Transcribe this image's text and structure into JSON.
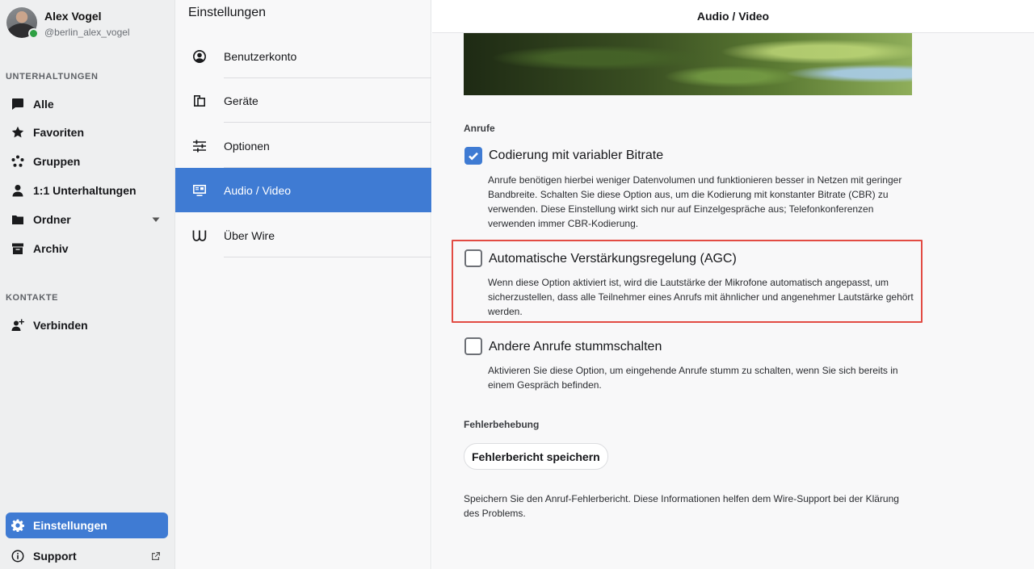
{
  "user": {
    "name": "Alex Vogel",
    "handle": "@berlin_alex_vogel"
  },
  "sidebar": {
    "conversations_title": "UNTERHALTUNGEN",
    "items": [
      {
        "label": "Alle",
        "icon": "chat-bubble-icon"
      },
      {
        "label": "Favoriten",
        "icon": "star-icon"
      },
      {
        "label": "Gruppen",
        "icon": "group-icon"
      },
      {
        "label": "1:1 Unterhaltungen",
        "icon": "person-icon"
      },
      {
        "label": "Ordner",
        "icon": "folder-icon"
      },
      {
        "label": "Archiv",
        "icon": "archive-icon"
      }
    ],
    "contacts_title": "KONTAKTE",
    "connect_label": "Verbinden",
    "settings_label": "Einstellungen",
    "support_label": "Support"
  },
  "settings_menu": {
    "title": "Einstellungen",
    "items": [
      {
        "label": "Benutzerkonto",
        "icon": "account-icon"
      },
      {
        "label": "Geräte",
        "icon": "devices-icon"
      },
      {
        "label": "Optionen",
        "icon": "sliders-icon"
      },
      {
        "label": "Audio / Video",
        "icon": "audio-video-icon"
      },
      {
        "label": "Über Wire",
        "icon": "wire-logo-icon"
      }
    ],
    "active_index": 3
  },
  "main": {
    "header_title": "Audio / Video",
    "calls_section_label": "Anrufe",
    "options": [
      {
        "title": "Codierung mit variabler Bitrate",
        "checked": true,
        "description": "Anrufe benötigen hierbei weniger Datenvolumen und funktionieren besser in Netzen mit geringer Bandbreite. Schalten Sie diese Option aus, um die Kodierung mit konstanter Bitrate (CBR) zu verwenden. Diese Einstellung wirkt sich nur auf Einzelgespräche aus; Telefonkonferenzen verwenden immer CBR-Kodierung."
      },
      {
        "title": "Automatische Verstärkungsregelung (AGC)",
        "checked": false,
        "description": "Wenn diese Option aktiviert ist, wird die Lautstärke der Mikrofone automatisch angepasst, um sicherzustellen, dass alle Teilnehmer eines Anrufs mit ähnlicher und angenehmer Lautstärke gehört werden."
      },
      {
        "title": "Andere Anrufe stummschalten",
        "checked": false,
        "description": "Aktivieren Sie diese Option, um eingehende Anrufe stumm zu schalten, wenn Sie sich bereits in einem Gespräch befinden."
      }
    ],
    "troubleshooting_label": "Fehlerbehebung",
    "save_report_button": "Fehlerbericht speichern",
    "save_report_description": "Speichern Sie den Anruf-Fehlerbericht. Diese Informationen helfen dem Wire-Support bei der Klärung des Problems."
  },
  "colors": {
    "accent": "#3f7bd3",
    "highlight": "#e24b43",
    "online": "#2ea043"
  }
}
